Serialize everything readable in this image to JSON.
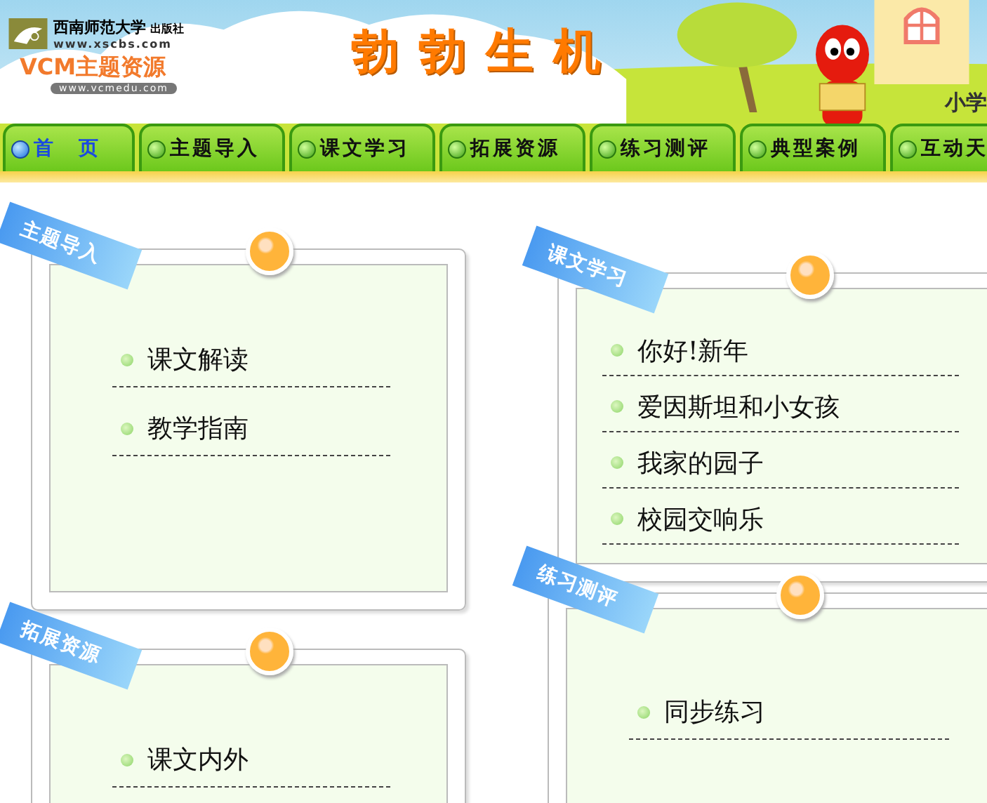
{
  "header": {
    "publisher": {
      "name": "西南师范大学",
      "suffix": "出版社",
      "url": "www.xscbs.com"
    },
    "brand": {
      "name": "VCM主题资源",
      "url": "www.vcmedu.com"
    },
    "title": "勃勃生机",
    "corner_text": "小学"
  },
  "nav_tabs": [
    {
      "label": "首　页",
      "selected": true
    },
    {
      "label": "主题导入",
      "selected": false
    },
    {
      "label": "课文学习",
      "selected": false
    },
    {
      "label": "拓展资源",
      "selected": false
    },
    {
      "label": "练习测评",
      "selected": false
    },
    {
      "label": "典型案例",
      "selected": false
    },
    {
      "label": "互动天",
      "selected": false
    }
  ],
  "sections": [
    {
      "ribbon": "主题导入",
      "items": [
        "课文解读",
        "教学指南"
      ]
    },
    {
      "ribbon": "课文学习",
      "items": [
        "你好!新年",
        "爱因斯坦和小女孩",
        "我家的园子",
        "校园交响乐"
      ]
    },
    {
      "ribbon": "拓展资源",
      "items": [
        "课文内外"
      ]
    },
    {
      "ribbon": "练习测评",
      "items": [
        "同步练习"
      ]
    }
  ]
}
